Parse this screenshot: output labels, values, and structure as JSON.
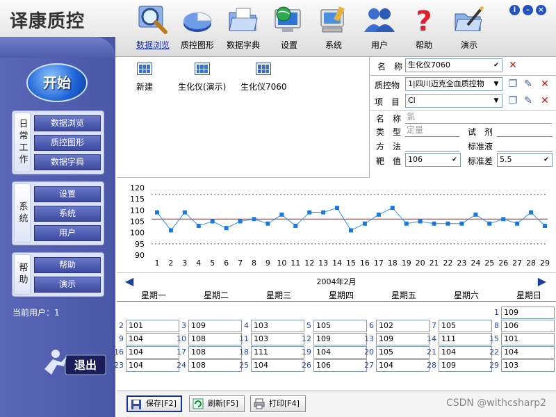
{
  "app": {
    "title": "译康质控"
  },
  "toolbar": {
    "items": [
      {
        "label": "数据浏览",
        "icon": "magnifier-icon"
      },
      {
        "label": "质控图形",
        "icon": "pie-chart-icon"
      },
      {
        "label": "数据字典",
        "icon": "folder-icon"
      },
      {
        "label": "设置",
        "icon": "monitor-globe-icon"
      },
      {
        "label": "系统",
        "icon": "computer-tools-icon"
      },
      {
        "label": "用户",
        "icon": "users-icon"
      },
      {
        "label": "帮助",
        "icon": "question-icon"
      },
      {
        "label": "演示",
        "icon": "folder-pen-icon"
      }
    ],
    "active_index": 0
  },
  "window_buttons": {
    "info": "i",
    "minimize": "–",
    "close": "×"
  },
  "sidebar": {
    "start_label": "开始",
    "groups": [
      {
        "title": "日常工作",
        "items": [
          "数据浏览",
          "质控图形",
          "数据字典"
        ]
      },
      {
        "title": "系统",
        "items": [
          "设置",
          "系统",
          "用户"
        ]
      },
      {
        "title": "帮助",
        "items": [
          "帮助",
          "演示"
        ]
      }
    ],
    "current_user": "当前用户：1",
    "exit_label": "退出"
  },
  "files": [
    {
      "label": "新建"
    },
    {
      "label": "生化仪(演示)"
    },
    {
      "label": "生化仪7060"
    }
  ],
  "props": {
    "name_label": "名　称",
    "name_value": "生化仪7060",
    "qc_label": "质控物",
    "qc_value": "1|四川迈克全血质控物",
    "item_label": "项　目",
    "item_value": "Cl",
    "n_label": "名　称",
    "n_value": "氯",
    "type_label": "类　型",
    "type_value": "定量",
    "reagent_label": "试　剂",
    "reagent_value": "",
    "method_label": "方　法",
    "method_value": "",
    "std_label": "标准液",
    "std_value": "",
    "target_label": "靶　值",
    "target_value": "106",
    "sd_label": "标准差",
    "sd_value": "5.5"
  },
  "chart_data": {
    "type": "line",
    "x": [
      1,
      2,
      3,
      4,
      5,
      6,
      7,
      8,
      9,
      10,
      11,
      12,
      13,
      14,
      15,
      16,
      17,
      18,
      19,
      20,
      21,
      22,
      23,
      24,
      25,
      26,
      27,
      28,
      29
    ],
    "values": [
      109,
      101,
      109,
      103,
      105,
      102,
      105,
      106,
      104,
      108,
      103,
      109,
      109,
      111,
      101,
      104,
      108,
      111,
      104,
      105,
      104,
      104,
      104,
      108,
      104,
      106,
      104,
      109,
      103
    ],
    "yticks": [
      90,
      95,
      100,
      105,
      110,
      115,
      120
    ],
    "ylim": [
      90,
      120
    ],
    "mean": 106,
    "limits": [
      95,
      117
    ],
    "colors": {
      "line": "#2f8fe8",
      "point": "#1a7ae0",
      "mean": "#c02020",
      "limit": "#555555"
    }
  },
  "calendar": {
    "title": "2004年2月",
    "weekdays": [
      "星期一",
      "星期二",
      "星期三",
      "星期四",
      "星期五",
      "星期六",
      "星期日"
    ],
    "rows": [
      [
        null,
        null,
        null,
        null,
        null,
        null,
        {
          "day": "1",
          "value": "109"
        }
      ],
      [
        {
          "day": "2",
          "value": "101"
        },
        {
          "day": "3",
          "value": "109"
        },
        {
          "day": "4",
          "value": "103"
        },
        {
          "day": "5",
          "value": "105"
        },
        {
          "day": "6",
          "value": "102"
        },
        {
          "day": "7",
          "value": "105"
        },
        {
          "day": "8",
          "value": "106"
        }
      ],
      [
        {
          "day": "9",
          "value": "104"
        },
        {
          "day": "10",
          "value": "108"
        },
        {
          "day": "11",
          "value": "103"
        },
        {
          "day": "12",
          "value": "109"
        },
        {
          "day": "13",
          "value": "109"
        },
        {
          "day": "14",
          "value": "111"
        },
        {
          "day": "15",
          "value": "101"
        }
      ],
      [
        {
          "day": "16",
          "value": "104"
        },
        {
          "day": "17",
          "value": "108"
        },
        {
          "day": "18",
          "value": "111"
        },
        {
          "day": "19",
          "value": "104"
        },
        {
          "day": "20",
          "value": "105"
        },
        {
          "day": "21",
          "value": "104"
        },
        {
          "day": "22",
          "value": "104"
        }
      ],
      [
        {
          "day": "23",
          "value": "104"
        },
        {
          "day": "24",
          "value": "108"
        },
        {
          "day": "25",
          "value": "104"
        },
        {
          "day": "26",
          "value": "106"
        },
        {
          "day": "27",
          "value": "104"
        },
        {
          "day": "28",
          "value": "109"
        },
        {
          "day": "29",
          "value": "103"
        }
      ]
    ]
  },
  "bottombar": {
    "save_label": "保存[F2]",
    "refresh_label": "刷新[F5]",
    "print_label": "打印[F4]"
  },
  "watermark": "CSDN @withcsharp2"
}
